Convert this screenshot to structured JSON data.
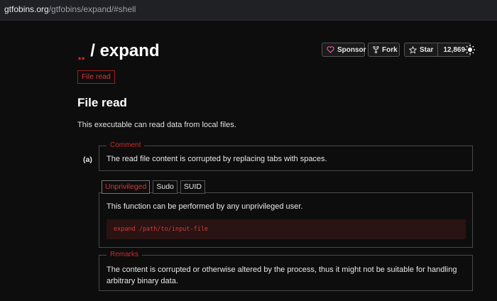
{
  "browser": {
    "url_host": "gtfobins.org",
    "url_path": "/gtfobins/expand/#shell"
  },
  "header": {
    "logo": "..",
    "separator": "/",
    "title": "expand"
  },
  "github": {
    "sponsor_label": "Sponsor",
    "fork_label": "Fork",
    "star_label": "Star",
    "star_count": "12,869"
  },
  "badge": "File read",
  "section": {
    "heading": "File read",
    "description": "This executable can read data from local files."
  },
  "entry": {
    "label": "(a)",
    "comment_legend": "Comment",
    "comment_text": "The read file content is corrupted by replacing tabs with spaces."
  },
  "tabs": [
    "Unprivileged",
    "Sudo",
    "SUID"
  ],
  "panel": {
    "text": "This function can be performed by any unprivileged user.",
    "code": "expand /path/to/input-file"
  },
  "remarks": {
    "legend": "Remarks",
    "text": "The content is corrupted or otherwise altered by the process, thus it might not be suitable for handling arbitrary binary data."
  },
  "colors": {
    "accent": "#cc2b2b",
    "background": "#0d0d0d",
    "code_bg": "#2a1313"
  }
}
